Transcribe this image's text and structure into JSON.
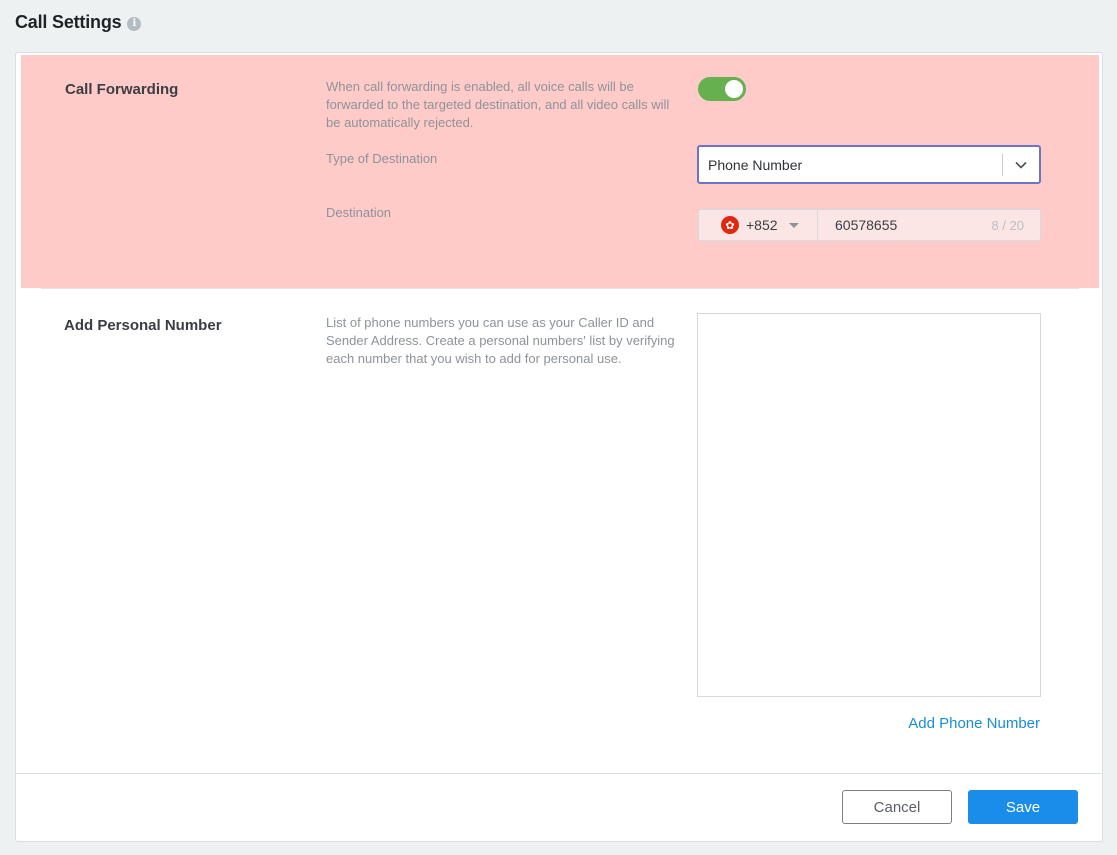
{
  "header": {
    "title": "Call Settings",
    "info_icon": "info-icon"
  },
  "call_forwarding": {
    "title": "Call Forwarding",
    "description": "When call forwarding is enabled, all voice calls will be forwarded to the targeted destination, and all video calls will be automatically rejected.",
    "enabled": true,
    "toggle_color": "#66b04f",
    "highlight_color": "#ffcbc8",
    "destination_type": {
      "label": "Type of Destination",
      "selected": "Phone Number"
    },
    "destination": {
      "label": "Destination",
      "country_flag": "hong-kong-flag",
      "country_code": "+852",
      "phone_number": "60578655",
      "char_count": "8 / 20"
    }
  },
  "personal_number": {
    "title": "Add Personal Number",
    "description": "List of phone numbers you can use as your Caller ID and Sender Address. Create a personal numbers' list by verifying each number that you wish to add for personal use.",
    "numbers": [],
    "add_link": "Add Phone Number",
    "link_color": "#1a8cd8"
  },
  "footer": {
    "cancel_label": "Cancel",
    "save_label": "Save",
    "save_color": "#1a8cea"
  }
}
